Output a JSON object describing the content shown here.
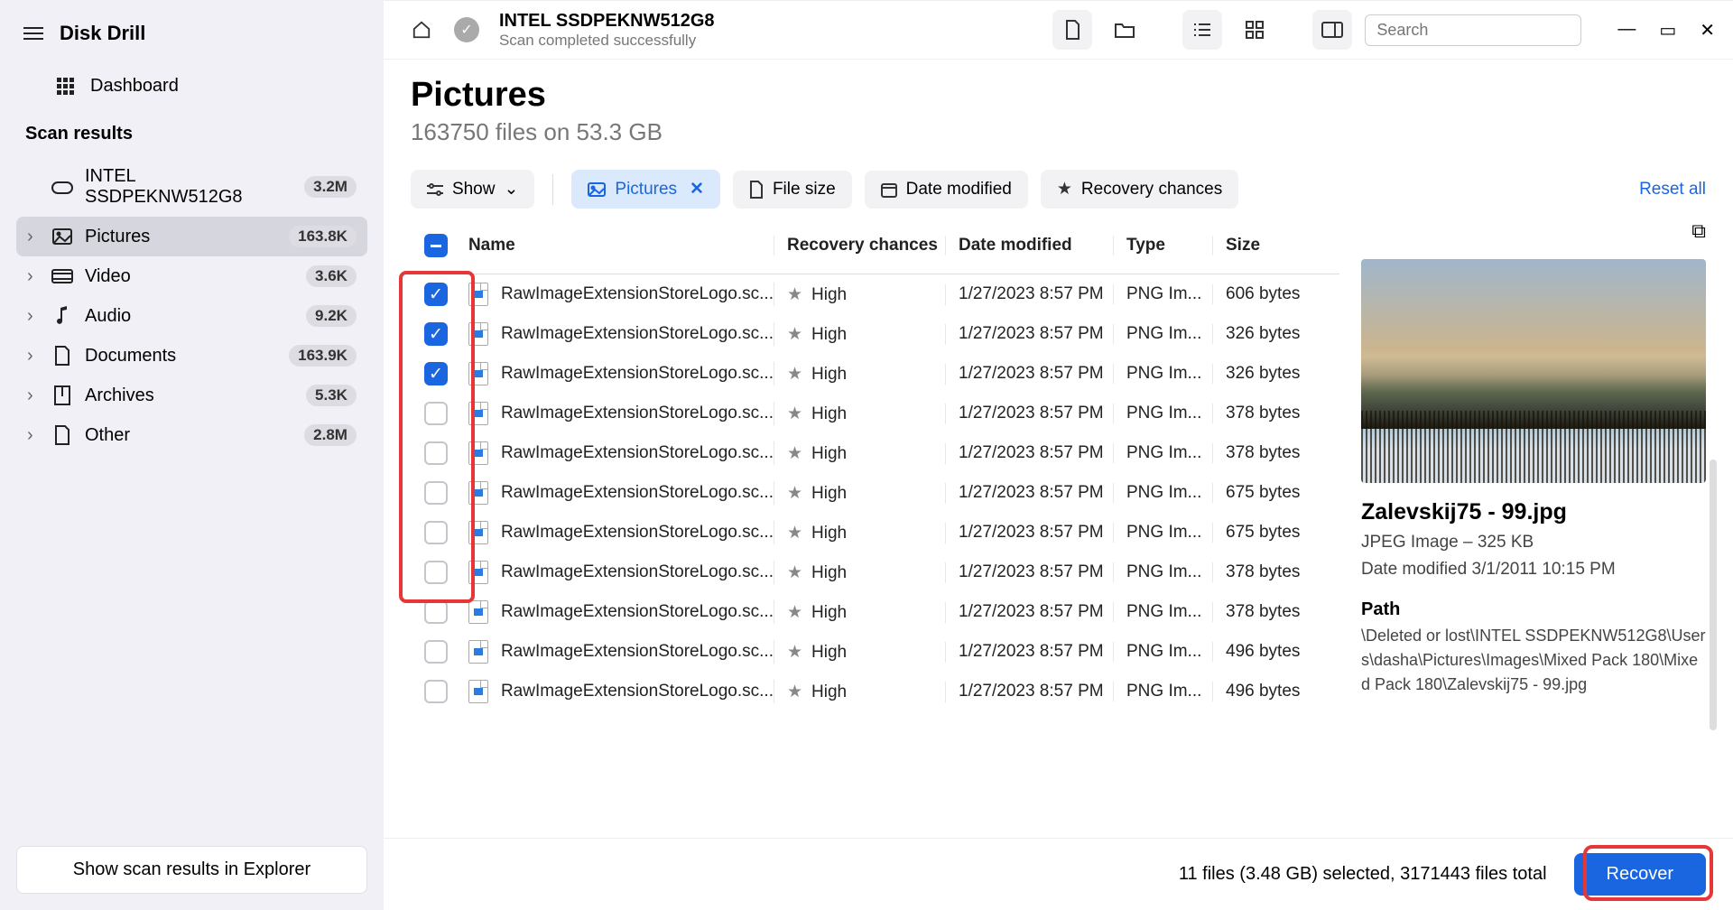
{
  "app_title": "Disk Drill",
  "dashboard_label": "Dashboard",
  "scan_results_label": "Scan results",
  "device_tree": {
    "name": "INTEL SSDPEKNW512G8",
    "badge": "3.2M",
    "items": [
      {
        "label": "Pictures",
        "badge": "163.8K",
        "active": true
      },
      {
        "label": "Video",
        "badge": "3.6K"
      },
      {
        "label": "Audio",
        "badge": "9.2K"
      },
      {
        "label": "Documents",
        "badge": "163.9K"
      },
      {
        "label": "Archives",
        "badge": "5.3K"
      },
      {
        "label": "Other",
        "badge": "2.8M"
      }
    ]
  },
  "show_in_explorer": "Show scan results in Explorer",
  "header": {
    "device": "INTEL SSDPEKNW512G8",
    "status": "Scan completed successfully",
    "search_placeholder": "Search"
  },
  "page": {
    "title": "Pictures",
    "subtitle": "163750 files on 53.3 GB"
  },
  "filters": {
    "show": "Show",
    "pictures": "Pictures",
    "file_size": "File size",
    "date_modified": "Date modified",
    "recovery_chances": "Recovery chances",
    "reset": "Reset all"
  },
  "columns": {
    "name": "Name",
    "recovery": "Recovery chances",
    "date": "Date modified",
    "type": "Type",
    "size": "Size"
  },
  "rows": [
    {
      "checked": true,
      "name": "RawImageExtensionStoreLogo.sc...",
      "rec": "High",
      "date": "1/27/2023 8:57 PM",
      "type": "PNG Im...",
      "size": "606 bytes"
    },
    {
      "checked": true,
      "name": "RawImageExtensionStoreLogo.sc...",
      "rec": "High",
      "date": "1/27/2023 8:57 PM",
      "type": "PNG Im...",
      "size": "326 bytes"
    },
    {
      "checked": true,
      "name": "RawImageExtensionStoreLogo.sc...",
      "rec": "High",
      "date": "1/27/2023 8:57 PM",
      "type": "PNG Im...",
      "size": "326 bytes"
    },
    {
      "checked": false,
      "name": "RawImageExtensionStoreLogo.sc...",
      "rec": "High",
      "date": "1/27/2023 8:57 PM",
      "type": "PNG Im...",
      "size": "378 bytes"
    },
    {
      "checked": false,
      "name": "RawImageExtensionStoreLogo.sc...",
      "rec": "High",
      "date": "1/27/2023 8:57 PM",
      "type": "PNG Im...",
      "size": "378 bytes"
    },
    {
      "checked": false,
      "name": "RawImageExtensionStoreLogo.sc...",
      "rec": "High",
      "date": "1/27/2023 8:57 PM",
      "type": "PNG Im...",
      "size": "675 bytes"
    },
    {
      "checked": false,
      "name": "RawImageExtensionStoreLogo.sc...",
      "rec": "High",
      "date": "1/27/2023 8:57 PM",
      "type": "PNG Im...",
      "size": "675 bytes"
    },
    {
      "checked": false,
      "name": "RawImageExtensionStoreLogo.sc...",
      "rec": "High",
      "date": "1/27/2023 8:57 PM",
      "type": "PNG Im...",
      "size": "378 bytes"
    },
    {
      "checked": false,
      "name": "RawImageExtensionStoreLogo.sc...",
      "rec": "High",
      "date": "1/27/2023 8:57 PM",
      "type": "PNG Im...",
      "size": "378 bytes"
    },
    {
      "checked": false,
      "name": "RawImageExtensionStoreLogo.sc...",
      "rec": "High",
      "date": "1/27/2023 8:57 PM",
      "type": "PNG Im...",
      "size": "496 bytes"
    },
    {
      "checked": false,
      "name": "RawImageExtensionStoreLogo.sc...",
      "rec": "High",
      "date": "1/27/2023 8:57 PM",
      "type": "PNG Im...",
      "size": "496 bytes"
    }
  ],
  "preview": {
    "title": "Zalevskij75 - 99.jpg",
    "meta1": "JPEG Image – 325 KB",
    "meta2": "Date modified 3/1/2011 10:15 PM",
    "path_label": "Path",
    "path": "\\Deleted or lost\\INTEL SSDPEKNW512G8\\Users\\dasha\\Pictures\\Images\\Mixed Pack 180\\Mixed  Pack 180\\Zalevskij75 - 99.jpg"
  },
  "footer": {
    "text": "11 files (3.48 GB) selected, 3171443 files total",
    "recover": "Recover"
  }
}
